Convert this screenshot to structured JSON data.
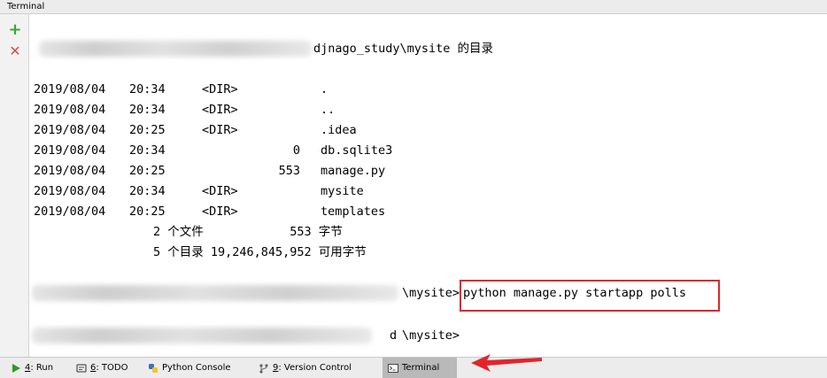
{
  "window": {
    "title": "Terminal"
  },
  "gutter": {
    "add_glyph": "+",
    "close_glyph": "✕"
  },
  "terminal": {
    "dir_header": "djnago_study\\mysite 的目录",
    "listing": [
      {
        "date": "2019/08/04",
        "time": "20:34",
        "type": "<DIR>",
        "size": "",
        "name": "."
      },
      {
        "date": "2019/08/04",
        "time": "20:34",
        "type": "<DIR>",
        "size": "",
        "name": ".."
      },
      {
        "date": "2019/08/04",
        "time": "20:25",
        "type": "<DIR>",
        "size": "",
        "name": ".idea"
      },
      {
        "date": "2019/08/04",
        "time": "20:34",
        "type": "",
        "size": "0",
        "name": "db.sqlite3"
      },
      {
        "date": "2019/08/04",
        "time": "20:25",
        "type": "",
        "size": "553",
        "name": "manage.py"
      },
      {
        "date": "2019/08/04",
        "time": "20:34",
        "type": "<DIR>",
        "size": "",
        "name": "mysite"
      },
      {
        "date": "2019/08/04",
        "time": "20:25",
        "type": "<DIR>",
        "size": "",
        "name": "templates"
      }
    ],
    "summary_files": "2 个文件            553 字节",
    "summary_dirs": "5 个目录 19,246,845,952 可用字节",
    "prompt1_path": "\\mysite>",
    "prompt1_command": "python manage.py startapp polls",
    "prompt2_path": "\\mysite>",
    "prompt2_partial": "d"
  },
  "toolbar": {
    "tabs": [
      {
        "num": "4",
        "label": ": Run",
        "icon": "run-icon",
        "color": "#2b9b2b"
      },
      {
        "num": "6",
        "label": ": TODO",
        "icon": "todo-icon",
        "color": "#555555"
      },
      {
        "num": "",
        "label": "Python Console",
        "icon": "python-icon",
        "color": "#3b73b9"
      },
      {
        "num": "9",
        "label": ": Version Control",
        "icon": "vcs-icon",
        "color": "#666666"
      },
      {
        "num": "",
        "label": "Terminal",
        "icon": "terminal-icon",
        "color": "#444444"
      }
    ]
  },
  "colors": {
    "highlight": "#e0262c",
    "arrow": "#e0262c"
  }
}
